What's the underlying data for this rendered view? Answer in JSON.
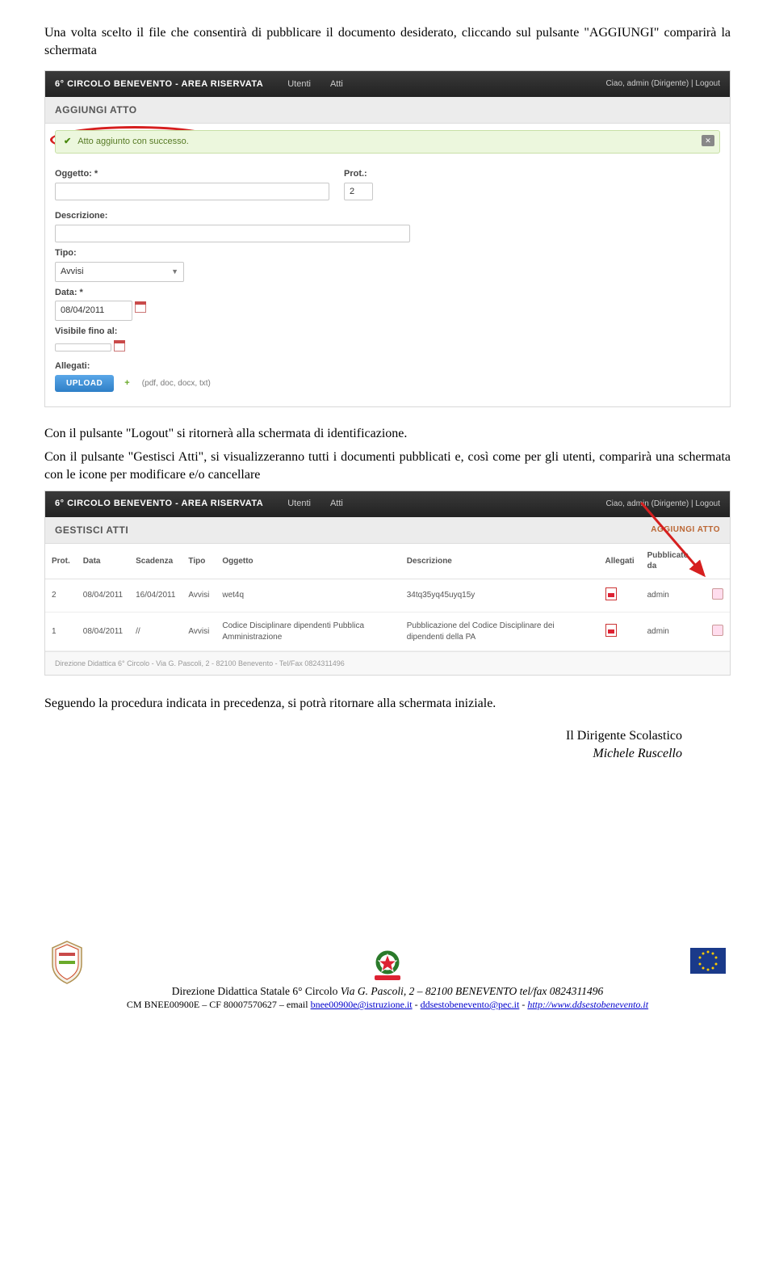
{
  "intro_para": "Una volta scelto il file che consentirà di pubblicare il documento desiderato, cliccando sul pulsante \"AGGIUNGI\" comparirà la schermata",
  "shot1": {
    "brand": "6° CIRCOLO BENEVENTO - AREA RISERVATA",
    "nav": {
      "utenti": "Utenti",
      "atti": "Atti"
    },
    "userinfo": "Ciao, admin (Dirigente) | Logout",
    "panel_title": "AGGIUNGI ATTO",
    "success_msg": "Atto aggiunto con successo.",
    "labels": {
      "oggetto": "Oggetto: *",
      "prot": "Prot.:",
      "descrizione": "Descrizione:",
      "tipo": "Tipo:",
      "data": "Data: *",
      "visibile": "Visibile fino al:",
      "allegati": "Allegati:"
    },
    "values": {
      "prot": "2",
      "tipo": "Avvisi",
      "data": "08/04/2011"
    },
    "upload_label": "UPLOAD",
    "upload_hint": "(pdf, doc, docx, txt)"
  },
  "mid_para1": "Con il pulsante \"Logout\" si ritornerà alla schermata di identificazione.",
  "mid_para2": "Con il pulsante \"Gestisci Atti\", si visualizzeranno tutti i documenti pubblicati e, così come per gli utenti, comparirà una schermata con le icone per modificare e/o cancellare",
  "shot2": {
    "brand": "6° CIRCOLO BENEVENTO - AREA RISERVATA",
    "nav": {
      "utenti": "Utenti",
      "atti": "Atti"
    },
    "userinfo": "Ciao, admin (Dirigente) | Logout",
    "panel_title": "GESTISCI ATTI",
    "add_link": "AGGIUNGI ATTO",
    "headers": {
      "prot": "Prot.",
      "data": "Data",
      "scadenza": "Scadenza",
      "tipo": "Tipo",
      "oggetto": "Oggetto",
      "descrizione": "Descrizione",
      "allegati": "Allegati",
      "pubblicato": "Pubblicato da"
    },
    "rows": [
      {
        "prot": "2",
        "data": "08/04/2011",
        "scadenza": "16/04/2011",
        "tipo": "Avvisi",
        "oggetto": "wet4q",
        "descrizione": "34tq35yq45uyq15y",
        "pubblicato": "admin"
      },
      {
        "prot": "1",
        "data": "08/04/2011",
        "scadenza": "//",
        "tipo": "Avvisi",
        "oggetto": "Codice Disciplinare dipendenti Pubblica Amministrazione",
        "descrizione": "Pubblicazione del Codice Disciplinare dei dipendenti della PA",
        "pubblicato": "admin"
      }
    ],
    "footline": "Direzione Didattica 6° Circolo - Via G. Pascoli, 2 - 82100 Benevento - Tel/Fax 0824311496"
  },
  "closing_para": "Seguendo la procedura indicata in precedenza, si potrà ritornare alla schermata iniziale.",
  "signature": {
    "role": "Il Dirigente Scolastico",
    "name": "Michele Ruscello"
  },
  "footer": {
    "line1_a": "Direzione Didattica Statale 6° Circolo ",
    "line1_b": "Via G. Pascoli, 2 – 82100 BENEVENTO   tel/fax 0824311496",
    "line2_a": "CM  BNEE00900E – CF 80007570627 – email ",
    "email1": "bnee00900e@istruzione.it",
    "sep1": " - ",
    "email2": "ddsestobenevento@pec.it",
    "sep2": " - ",
    "url": "http://www.ddsestobenevento.it"
  }
}
